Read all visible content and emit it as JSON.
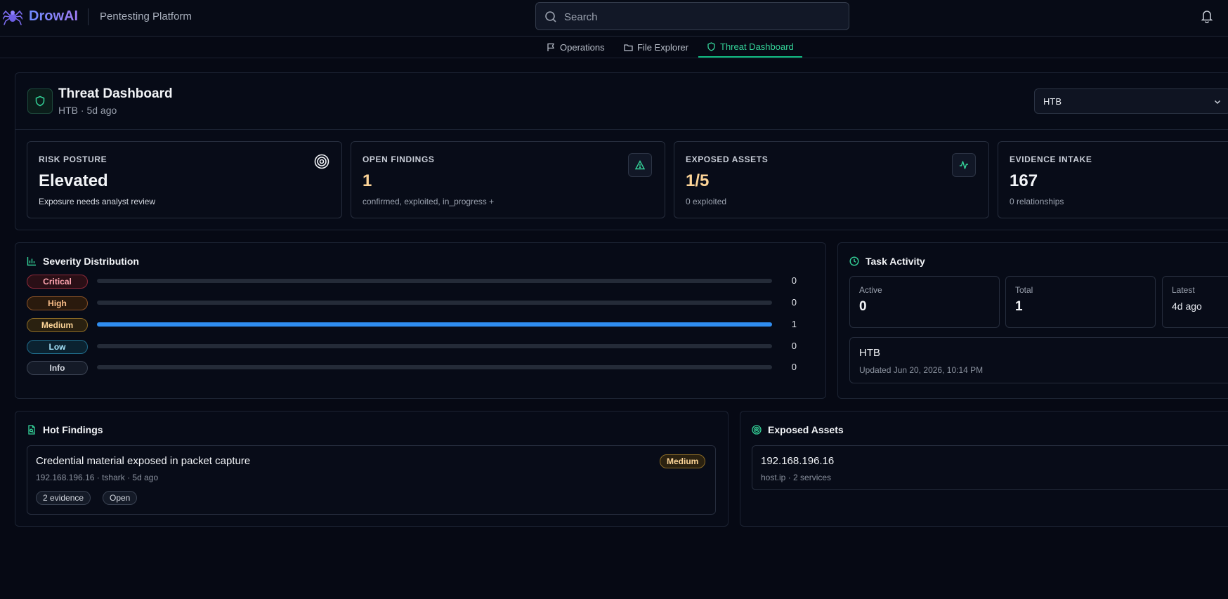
{
  "header": {
    "brand": "DrowAI",
    "subtitle": "Pentesting Platform",
    "search_placeholder": "Search"
  },
  "nav": {
    "tabs": [
      {
        "label": "Operations",
        "icon": "flag-icon"
      },
      {
        "label": "File Explorer",
        "icon": "folder-icon"
      },
      {
        "label": "Threat Dashboard",
        "icon": "shield-icon",
        "active": true
      }
    ]
  },
  "dashboard": {
    "title": "Threat Dashboard",
    "subtitle": "HTB · 5d ago",
    "selector_value": "HTB"
  },
  "stats": [
    {
      "label": "RISK POSTURE",
      "value": "Elevated",
      "note": "Exposure needs analyst review",
      "icon": "target-icon"
    },
    {
      "label": "OPEN FINDINGS",
      "value": "1",
      "note": "confirmed, exploited, in_progress +",
      "icon": "alert-triangle-icon"
    },
    {
      "label": "EXPOSED ASSETS",
      "value": "1/5",
      "note": "0 exploited",
      "icon": "activity-icon"
    },
    {
      "label": "EVIDENCE INTAKE",
      "value": "167",
      "note": "0 relationships"
    }
  ],
  "severity": {
    "title": "Severity Distribution",
    "rows": [
      {
        "label": "Critical",
        "count": "0",
        "fraction": 0
      },
      {
        "label": "High",
        "count": "0",
        "fraction": 0
      },
      {
        "label": "Medium",
        "count": "1",
        "fraction": 1
      },
      {
        "label": "Low",
        "count": "0",
        "fraction": 0
      },
      {
        "label": "Info",
        "count": "0",
        "fraction": 0
      }
    ]
  },
  "tasks": {
    "title": "Task Activity",
    "metrics": [
      {
        "label": "Active",
        "value": "0"
      },
      {
        "label": "Total",
        "value": "1"
      },
      {
        "label": "Latest",
        "value": "4d ago"
      }
    ],
    "item": {
      "name": "HTB",
      "updated": "Updated Jun 20, 2026, 10:14 PM"
    }
  },
  "hot_findings": {
    "title": "Hot Findings",
    "items": [
      {
        "title": "Credential material exposed in packet capture",
        "meta": "192.168.196.16 · tshark · 5d ago",
        "severity": "Medium",
        "tags": [
          "2 evidence",
          "Open"
        ]
      }
    ]
  },
  "exposed_assets": {
    "title": "Exposed Assets",
    "items": [
      {
        "ip": "192.168.196.16",
        "meta": "host.ip · 2 services"
      }
    ]
  },
  "colors": {
    "accent": "#10b981",
    "medium_bar": "#2f8df0",
    "amber": "#fcd497"
  }
}
